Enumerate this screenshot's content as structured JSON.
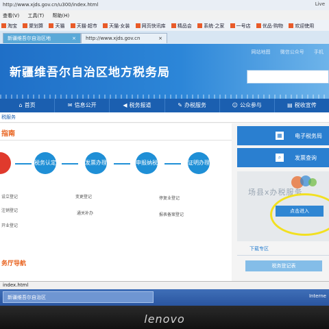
{
  "browser": {
    "url": "http://www.xjds.gov.cn/u300/index.html",
    "live_label": "Live",
    "menu": [
      "查看(V)",
      "工具(T)",
      "帮助(H)"
    ],
    "favorites": [
      "淘宝",
      "聚划算",
      "天猫",
      "天猫·超市",
      "天猫·女装",
      "网页快讯库",
      "精品会",
      "系统·之家",
      "一号店",
      "优品·购物",
      "欢迎使用"
    ],
    "tabs": [
      {
        "label": "新疆维吾尔自治区地"
      },
      {
        "label": "http://www.xjds.gov.cn"
      }
    ]
  },
  "header": {
    "title": "新疆维吾尔自治区地方税务局",
    "toplinks": [
      "网站地图",
      "微信公众号",
      "手机"
    ]
  },
  "nav": {
    "items": [
      {
        "icon": "home-icon",
        "label": "首页"
      },
      {
        "icon": "chat-icon",
        "label": "信息公开"
      },
      {
        "icon": "megaphone-icon",
        "label": "税务报道"
      },
      {
        "icon": "doc-icon",
        "label": "办税服务"
      },
      {
        "icon": "people-icon",
        "label": "公众参与"
      },
      {
        "icon": "book-icon",
        "label": "税收宣传"
      }
    ]
  },
  "subtab": "税服务",
  "main": {
    "guide_title": "指南",
    "steps": [
      {
        "label": "税务认定",
        "accent": "blue"
      },
      {
        "label": "发票办理",
        "accent": "blue"
      },
      {
        "label": "申报纳税",
        "accent": "blue"
      },
      {
        "label": "证明办理",
        "accent": "blue"
      }
    ],
    "links": [
      "设立登记",
      "变更登记",
      "停复业登记",
      "注销登记",
      "通关补办",
      "报表备案登记",
      "开业登记"
    ],
    "nav_title": "务厅导航"
  },
  "side": {
    "etax_label": "电子税务局",
    "invoice_label": "发票查询",
    "promo_text": "场县x办税服务",
    "enter_label": "点击进入",
    "download_title": "下载专区",
    "download_btn": "税务登记表"
  },
  "status": {
    "text": "index.html"
  },
  "taskbar": {
    "item": "新疆维吾尔自治区",
    "right": "Interne"
  },
  "bezel": {
    "brand": "lenovo"
  },
  "colors": {
    "header_blue": "#2c86d8",
    "nav_blue": "#1b5fb0",
    "accent_orange": "#e8631f",
    "highlight_yellow": "#f2e021"
  }
}
